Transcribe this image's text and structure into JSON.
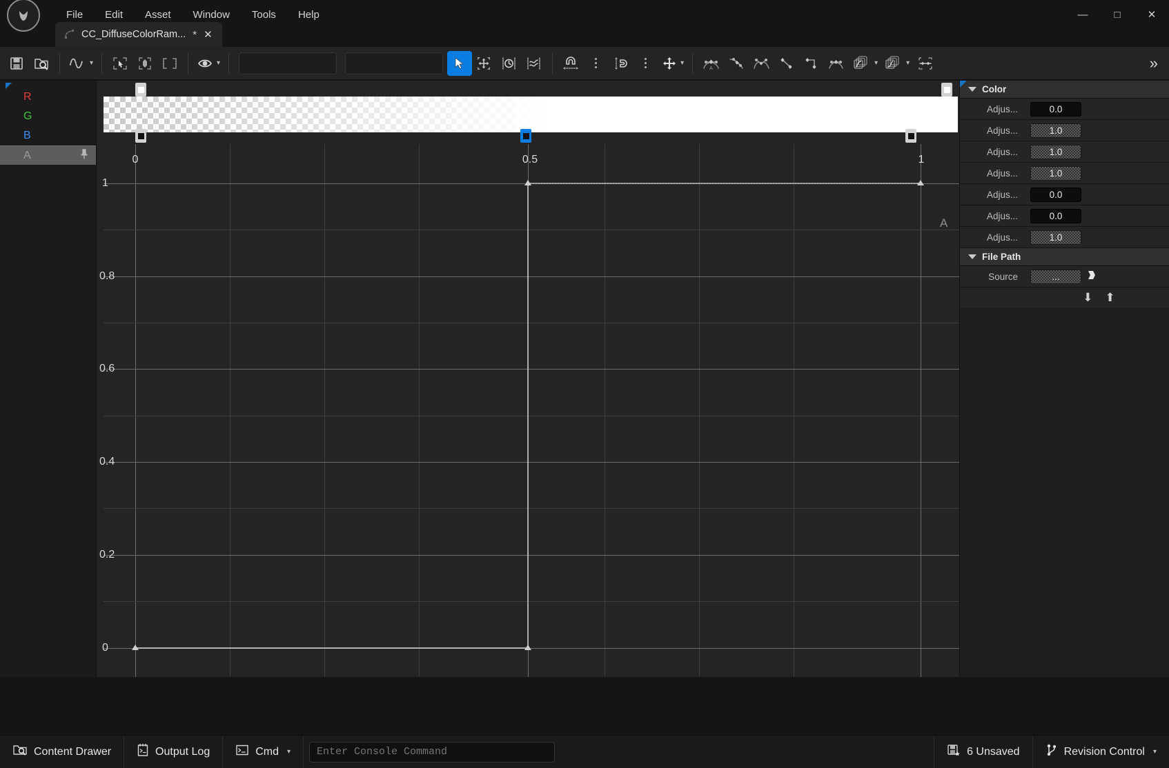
{
  "window": {
    "logo_alt": "unreal-engine-logo",
    "minimize": "—",
    "maximize": "□",
    "close": "✕"
  },
  "menu": {
    "items": [
      {
        "label": "File"
      },
      {
        "label": "Edit"
      },
      {
        "label": "Asset"
      },
      {
        "label": "Window"
      },
      {
        "label": "Tools"
      },
      {
        "label": "Help"
      }
    ]
  },
  "tab": {
    "title": "CC_DiffuseColorRam...",
    "dirty_marker": "*",
    "close": "✕"
  },
  "toolbar": {
    "save": "save-icon",
    "browse": "browse-content-icon",
    "curve_type": "curve-wave-icon",
    "select_tool": "select-box-icon",
    "transform_tool": "transform-tool-icon",
    "framing_tool": "framing-tool-icon",
    "visibility": "eye-icon",
    "combo_left_value": "",
    "combo_left_placeholder": "",
    "combo_right_value": "",
    "combo_right_placeholder": "",
    "cursor_tool": "cursor-arrow-icon",
    "move_tool": "move-all-directions-icon",
    "time_snap": "time-snap-clock-icon",
    "value_snap": "value-snap-wave-icon",
    "magnet_time": "magnet-horizontal-icon",
    "magnet_value": "magnet-vertical-icon",
    "pan_tool": "pan-arrows-icon",
    "tangent_auto": "tangent-auto-icon",
    "tangent_user": "tangent-user-icon",
    "tangent_break": "tangent-break-icon",
    "tangent_linear": "tangent-linear-icon",
    "tangent_constant": "tangent-constant-icon",
    "tangent_cubic": "tangent-cubic-icon",
    "pre_infinity": "pre-infinity-icon",
    "post_infinity": "post-infinity-icon",
    "flatten": "flatten-icon",
    "overflow": "»"
  },
  "channels": {
    "items": [
      {
        "label": "R",
        "color": "#e23b3b",
        "selected": false
      },
      {
        "label": "G",
        "color": "#3fc43f",
        "selected": false
      },
      {
        "label": "B",
        "color": "#3d8ef5",
        "selected": false
      },
      {
        "label": "A",
        "color": "#9a9a9a",
        "selected": true
      }
    ],
    "pin_icon": "pin-icon"
  },
  "graph": {
    "active_channel_tag": "A",
    "gradient_stops": [
      {
        "position": 0.0,
        "alpha": 0.0,
        "selected": false
      },
      {
        "position": 0.5,
        "alpha": 1.0,
        "selected": true
      },
      {
        "position": 1.0,
        "alpha": 1.0,
        "selected": false
      }
    ],
    "x_ticks": [
      {
        "value": "0",
        "pos": 0.0
      },
      {
        "value": "0.5",
        "pos": 0.5
      },
      {
        "value": "1",
        "pos": 1.0
      }
    ],
    "y_ticks": [
      {
        "value": "1",
        "pos": 1.0
      },
      {
        "value": "0.8",
        "pos": 0.8
      },
      {
        "value": "0.6",
        "pos": 0.6
      },
      {
        "value": "0.4",
        "pos": 0.4
      },
      {
        "value": "0.2",
        "pos": 0.2
      },
      {
        "value": "0",
        "pos": 0.0
      }
    ]
  },
  "chart_data": {
    "type": "line",
    "title": "",
    "xlabel": "",
    "ylabel": "",
    "xlim": [
      0,
      1
    ],
    "ylim": [
      0,
      1
    ],
    "grid": true,
    "legend": "none",
    "series": [
      {
        "name": "A",
        "keys": [
          {
            "x": 0.0,
            "y": 0.0
          },
          {
            "x": 0.5,
            "y": 0.0
          },
          {
            "x": 0.5,
            "y": 1.0
          },
          {
            "x": 1.0,
            "y": 1.0
          }
        ]
      }
    ],
    "x_ticks": [
      0,
      0.5,
      1
    ],
    "y_ticks": [
      0,
      0.2,
      0.4,
      0.6,
      0.8,
      1
    ]
  },
  "details": {
    "color_section": {
      "title": "Color",
      "rows": [
        {
          "label": "Adjus...",
          "value": "0.0",
          "hatched": false
        },
        {
          "label": "Adjus...",
          "value": "1.0",
          "hatched": true
        },
        {
          "label": "Adjus...",
          "value": "1.0",
          "hatched": true
        },
        {
          "label": "Adjus...",
          "value": "1.0",
          "hatched": true
        },
        {
          "label": "Adjus...",
          "value": "0.0",
          "hatched": false
        },
        {
          "label": "Adjus...",
          "value": "0.0",
          "hatched": false
        },
        {
          "label": "Adjus...",
          "value": "1.0",
          "hatched": true
        }
      ]
    },
    "filepath_section": {
      "title": "File Path",
      "source_label": "Source",
      "source_value": "...",
      "browse_icon": "folder-browse-icon"
    },
    "nav": {
      "down": "⬇",
      "up": "⬆"
    }
  },
  "statusbar": {
    "content_drawer": "Content Drawer",
    "output_log": "Output Log",
    "cmd": "Cmd",
    "console_value": "",
    "console_placeholder": "Enter Console Command",
    "unsaved": "6 Unsaved",
    "revision_control": "Revision Control"
  }
}
